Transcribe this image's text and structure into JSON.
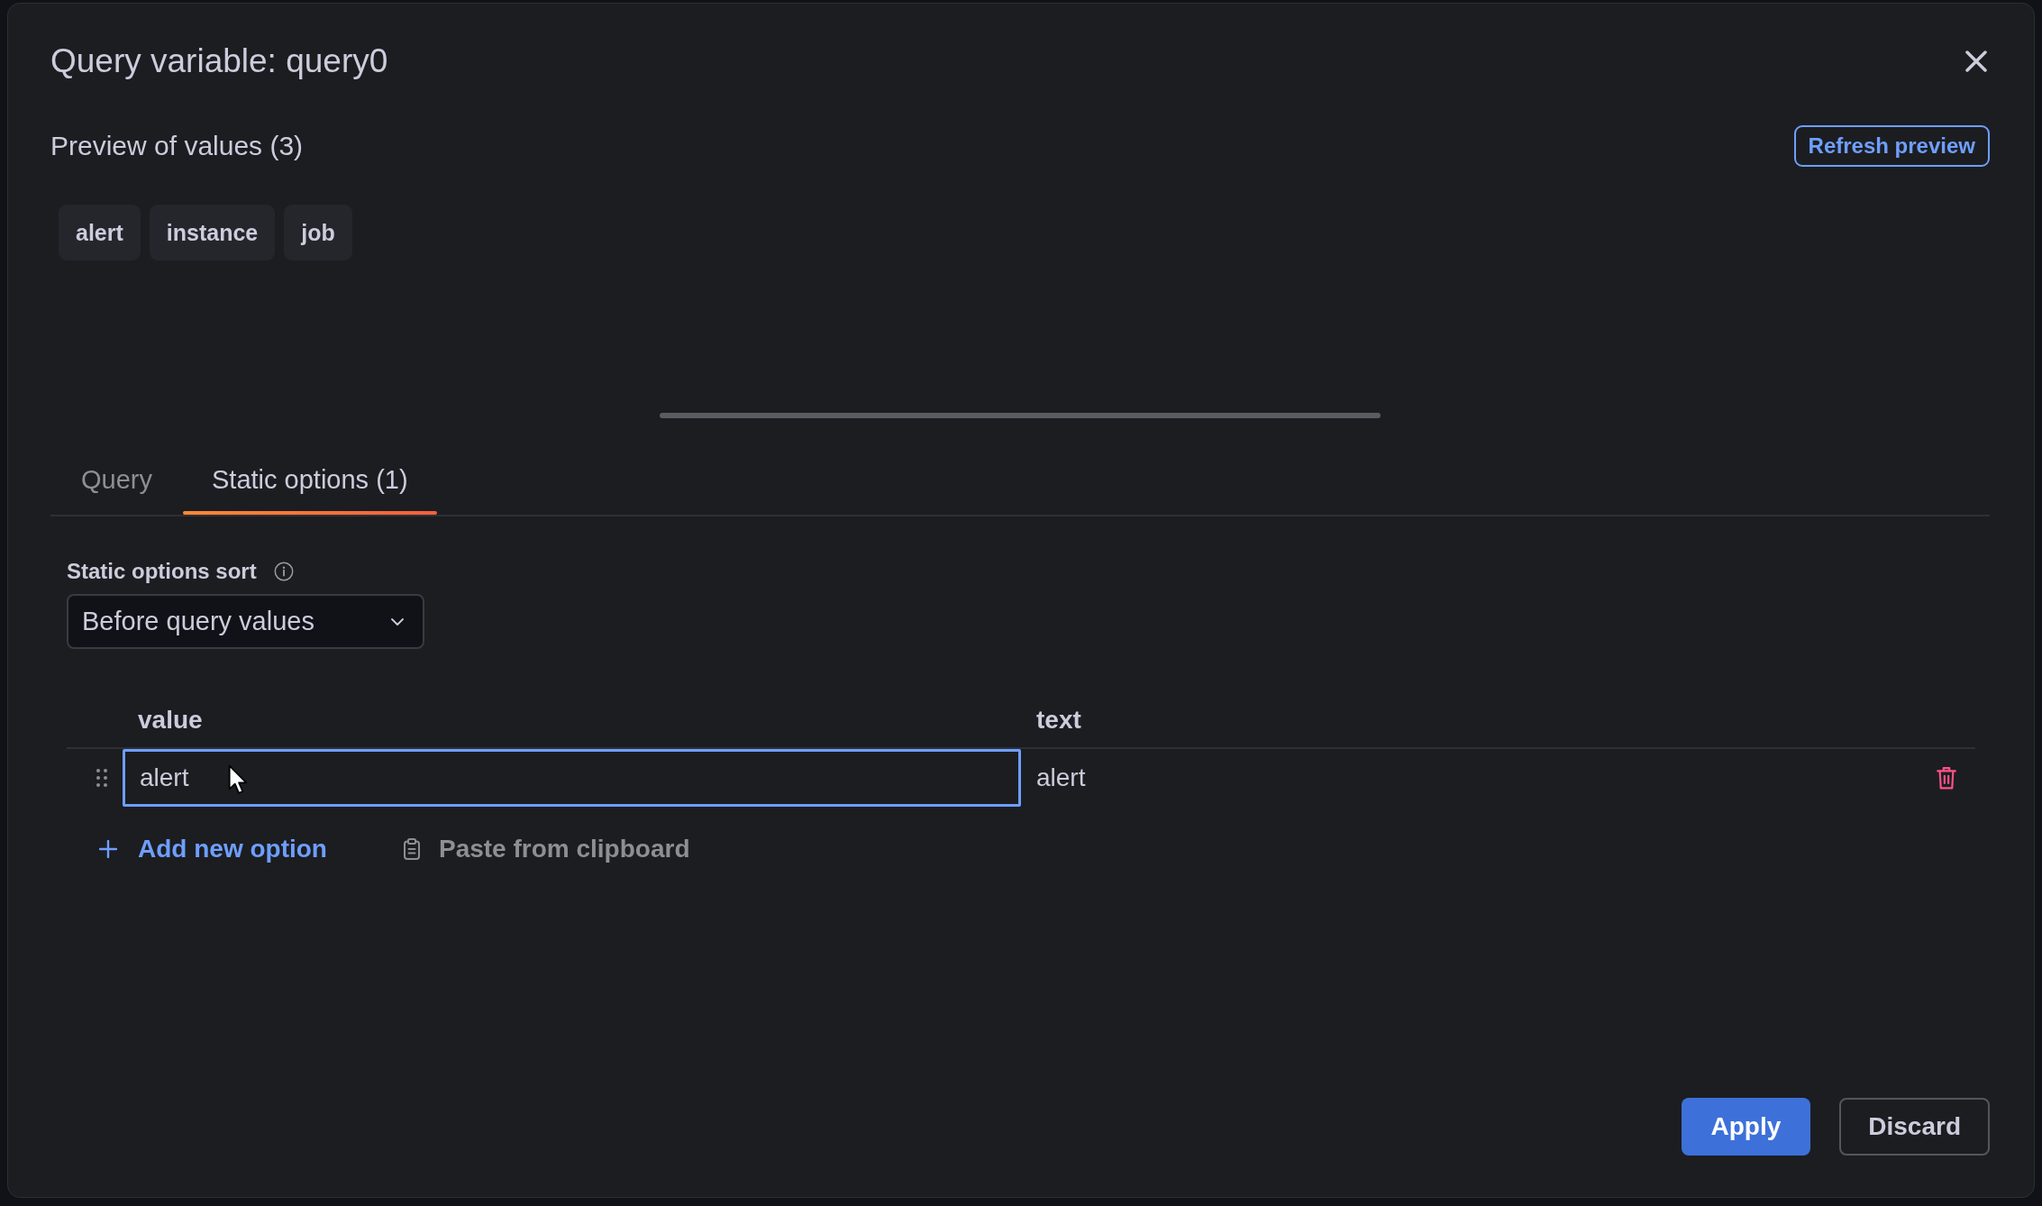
{
  "dialog": {
    "title": "Query variable: query0"
  },
  "preview": {
    "title": "Preview of values (3)",
    "refresh_button": "Refresh preview",
    "values": [
      "alert",
      "instance",
      "job"
    ]
  },
  "tabs": [
    {
      "label": "Query",
      "selected": false
    },
    {
      "label": "Static options (1)",
      "selected": true
    }
  ],
  "static_options": {
    "sort_field": {
      "label": "Static options sort",
      "value": "Before query values"
    },
    "table": {
      "columns": [
        "value",
        "text"
      ],
      "rows": [
        {
          "cells": [
            {
              "value": "alert",
              "focused": true
            },
            {
              "value": "alert",
              "focused": false
            }
          ]
        }
      ]
    },
    "add_button": "Add new option",
    "paste_button": "Paste from clipboard"
  },
  "footer": {
    "buttons": [
      {
        "label": "Apply",
        "kind": "primary"
      },
      {
        "label": "Discard",
        "kind": "secondary"
      }
    ]
  }
}
